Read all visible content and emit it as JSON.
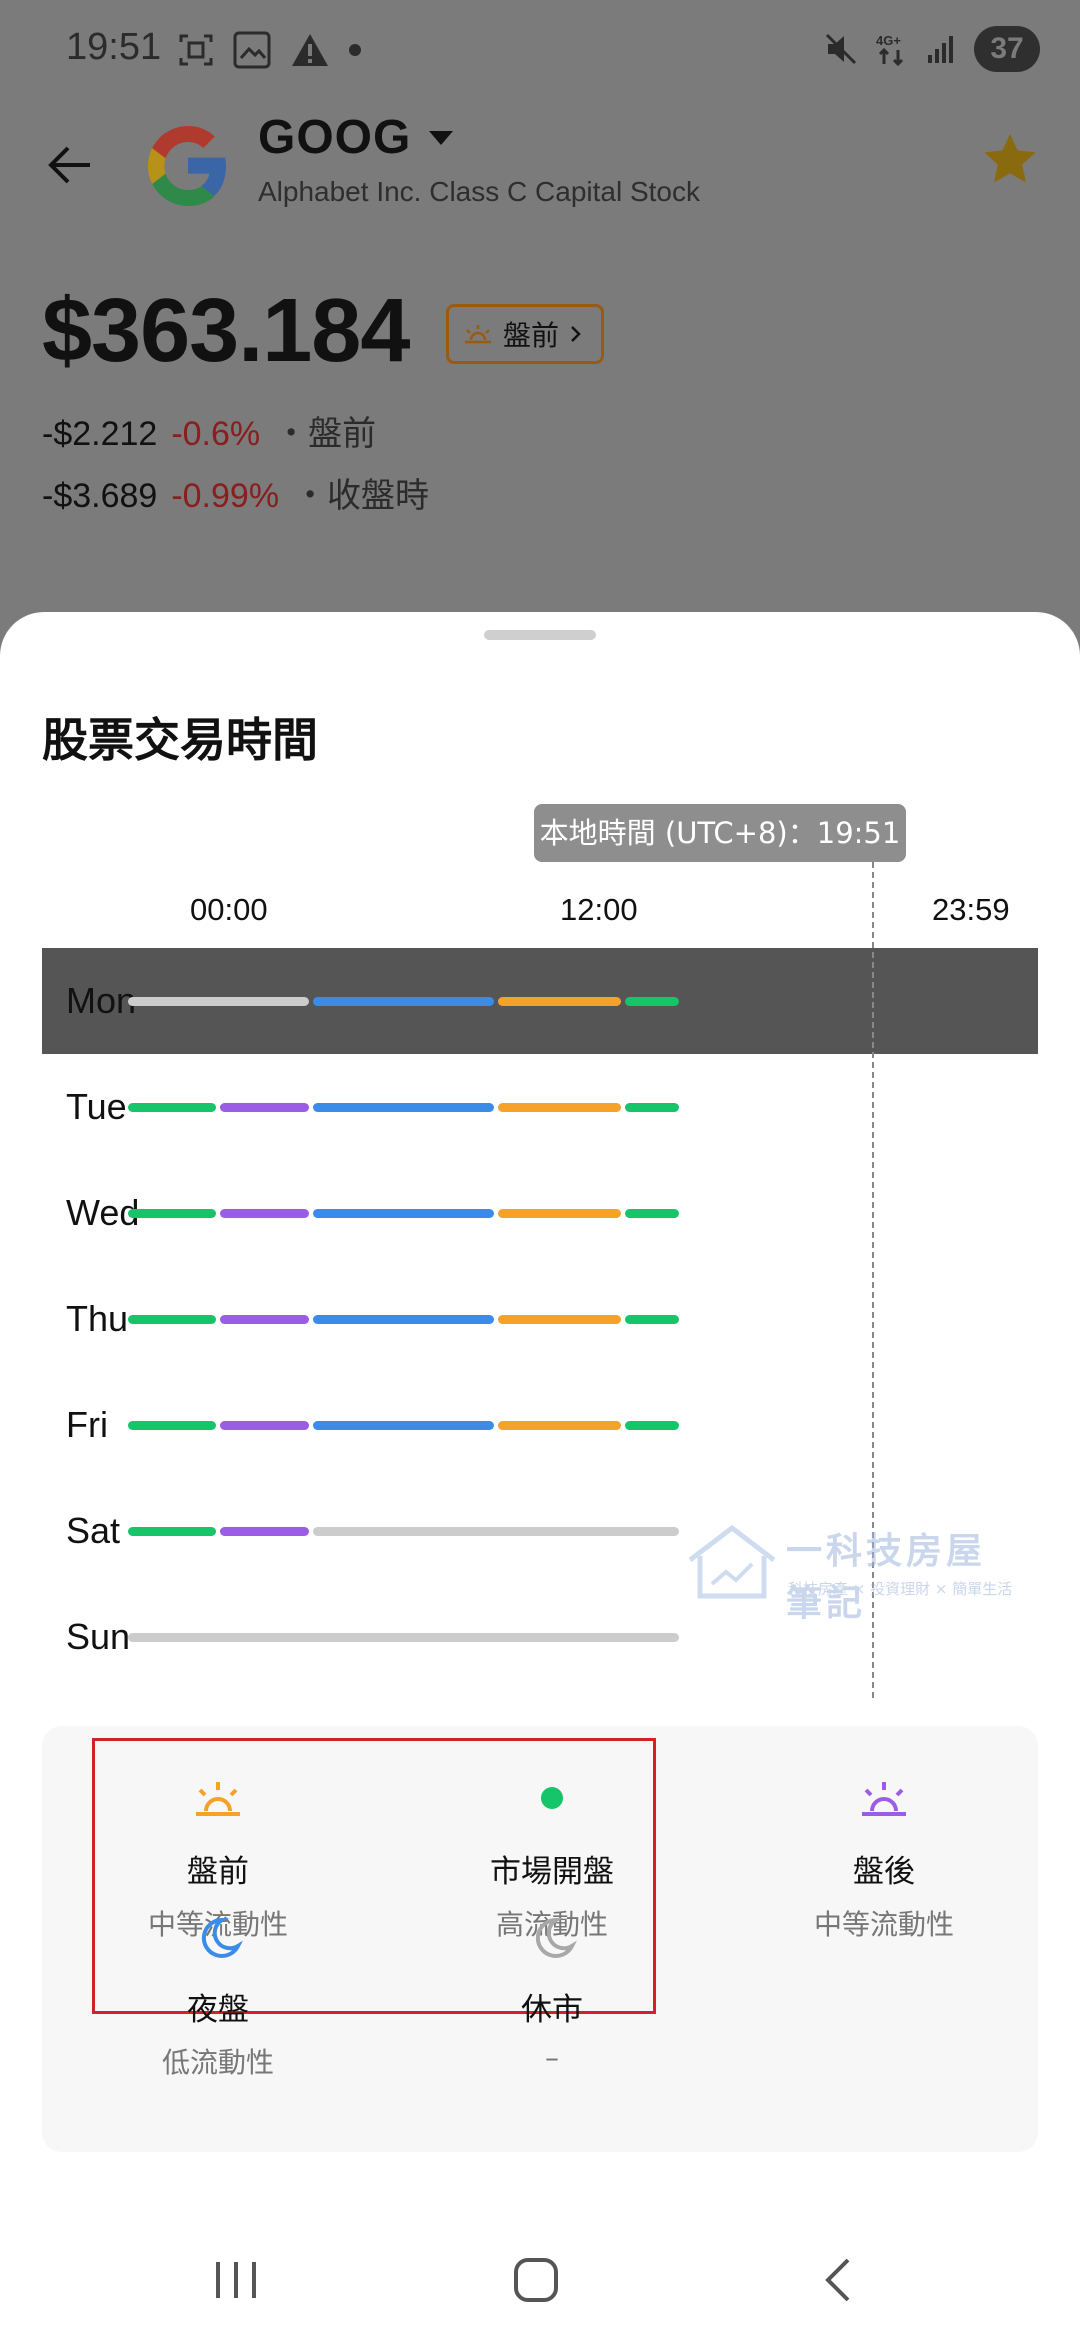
{
  "status_bar": {
    "time": "19:51",
    "battery": "37"
  },
  "stock": {
    "ticker": "GOOG",
    "company": "Alphabet Inc. Class C Capital Stock",
    "price": "$363.184",
    "session_chip": "盤前",
    "premarket": {
      "amount": "-$2.212",
      "percent": "-0.6%",
      "label": "・盤前"
    },
    "close": {
      "amount": "-$3.689",
      "percent": "-0.99%",
      "label": "・收盤時"
    }
  },
  "sheet": {
    "title": "股票交易時間",
    "tooltip": "本地時間 (UTC+8)：19:51",
    "time_axis": [
      "00:00",
      "12:00",
      "23:59"
    ],
    "current_day": "Mon",
    "colors": {
      "closed": "#cccccc",
      "regular": "#3b8be8",
      "pre": "#f5a12a",
      "post": "#9b5de5",
      "overnight": "#16c46a"
    },
    "days": [
      {
        "label": "Mon",
        "segments": [
          "closed",
          "regular",
          "pre",
          "overnight"
        ]
      },
      {
        "label": "Tue",
        "segments": [
          "overnight",
          "post",
          "regular",
          "pre",
          "overnight"
        ]
      },
      {
        "label": "Wed",
        "segments": [
          "overnight",
          "post",
          "regular",
          "pre",
          "overnight"
        ]
      },
      {
        "label": "Thu",
        "segments": [
          "overnight",
          "post",
          "regular",
          "pre",
          "overnight"
        ]
      },
      {
        "label": "Fri",
        "segments": [
          "overnight",
          "post",
          "regular",
          "pre",
          "overnight"
        ]
      },
      {
        "label": "Sat",
        "segments": [
          "overnight",
          "post",
          "closed"
        ]
      },
      {
        "label": "Sun",
        "segments": [
          "closed"
        ]
      }
    ],
    "legend": [
      {
        "icon": "sunrise-icon",
        "name": "盤前",
        "sub": "中等流動性",
        "color": "#f5a12a"
      },
      {
        "icon": "dot-icon",
        "name": "市場開盤",
        "sub": "高流動性",
        "color": "#16c46a"
      },
      {
        "icon": "sunset-icon",
        "name": "盤後",
        "sub": "中等流動性",
        "color": "#9b5de5"
      },
      {
        "icon": "moon-icon",
        "name": "夜盤",
        "sub": "低流動性",
        "color": "#3b8be8"
      },
      {
        "icon": "moon-icon",
        "name": "休市",
        "sub": "–",
        "color": "#a8a8a8"
      }
    ]
  },
  "watermark": {
    "title": "一科技房屋筆記",
    "subtitle": "科技房產 × 投資理財 × 簡單生活"
  }
}
